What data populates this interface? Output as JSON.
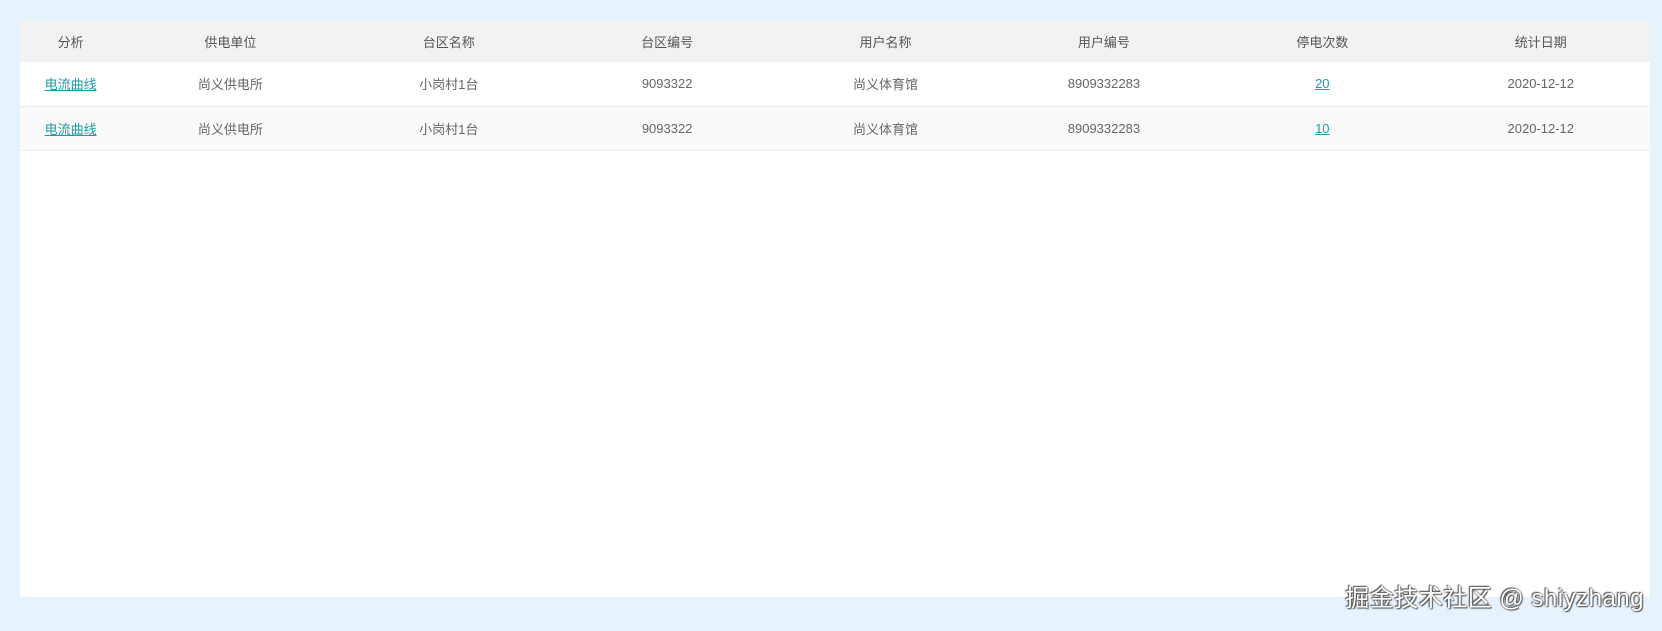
{
  "table": {
    "headers": [
      "分析",
      "供电单位",
      "台区名称",
      "台区编号",
      "用户名称",
      "用户编号",
      "停电次数",
      "统计日期"
    ],
    "rows": [
      {
        "analysis_link": "电流曲线",
        "supply_unit": "尚义供电所",
        "area_name": "小岗村1台",
        "area_code": "9093322",
        "user_name": "尚义体育馆",
        "user_no": "8909332283",
        "outage_count": "20",
        "stat_date": "2020-12-12"
      },
      {
        "analysis_link": "电流曲线",
        "supply_unit": "尚义供电所",
        "area_name": "小岗村1台",
        "area_code": "9093322",
        "user_name": "尚义体育馆",
        "user_no": "8909332283",
        "outage_count": "10",
        "stat_date": "2020-12-12"
      }
    ]
  },
  "watermark": "掘金技术社区 @ shiyzhang",
  "colors": {
    "page_background": "#e6f2fd",
    "header_background": "#f2f2f2",
    "link": "#1e9aa8"
  }
}
